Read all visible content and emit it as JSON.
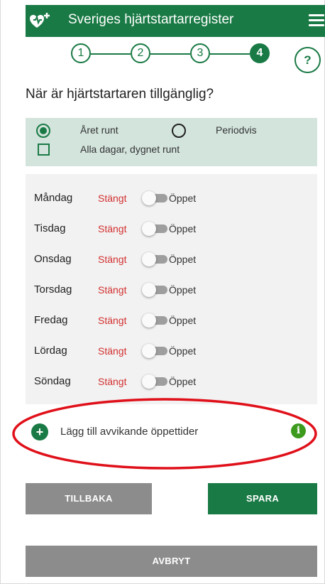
{
  "header": {
    "title": "Sveriges hjärtstartarregister",
    "logo_icon": "heart-defibrillator-icon",
    "menu_icon": "hamburger-menu-icon",
    "brand_color": "#1a7a45"
  },
  "stepper": {
    "steps": [
      "1",
      "2",
      "3",
      "4"
    ],
    "active_step": "4"
  },
  "help_button": {
    "label": "?"
  },
  "question": "När är hjärtstartaren tillgänglig?",
  "availability": {
    "options": [
      {
        "label": "Året runt",
        "selected": true
      },
      {
        "label": "Periodvis",
        "selected": false
      }
    ],
    "all_days_label": "Alla dagar, dygnet runt",
    "all_days_checked": false
  },
  "schedule": {
    "closed_label": "Stängt",
    "open_label": "Öppet",
    "days": [
      {
        "name": "Måndag",
        "open": false
      },
      {
        "name": "Tisdag",
        "open": false
      },
      {
        "name": "Onsdag",
        "open": false
      },
      {
        "name": "Torsdag",
        "open": false
      },
      {
        "name": "Fredag",
        "open": false
      },
      {
        "name": "Lördag",
        "open": false
      },
      {
        "name": "Söndag",
        "open": false
      }
    ]
  },
  "deviating_hours": {
    "add_icon": "+",
    "label": "Lägg till avvikande öppettider",
    "info_icon": "i",
    "info_color": "#3c9a1c"
  },
  "annotation": {
    "highlight_color": "#e0101a"
  },
  "buttons": {
    "back": "TILLBAKA",
    "save": "SPARA",
    "cancel": "AVBRYT"
  }
}
